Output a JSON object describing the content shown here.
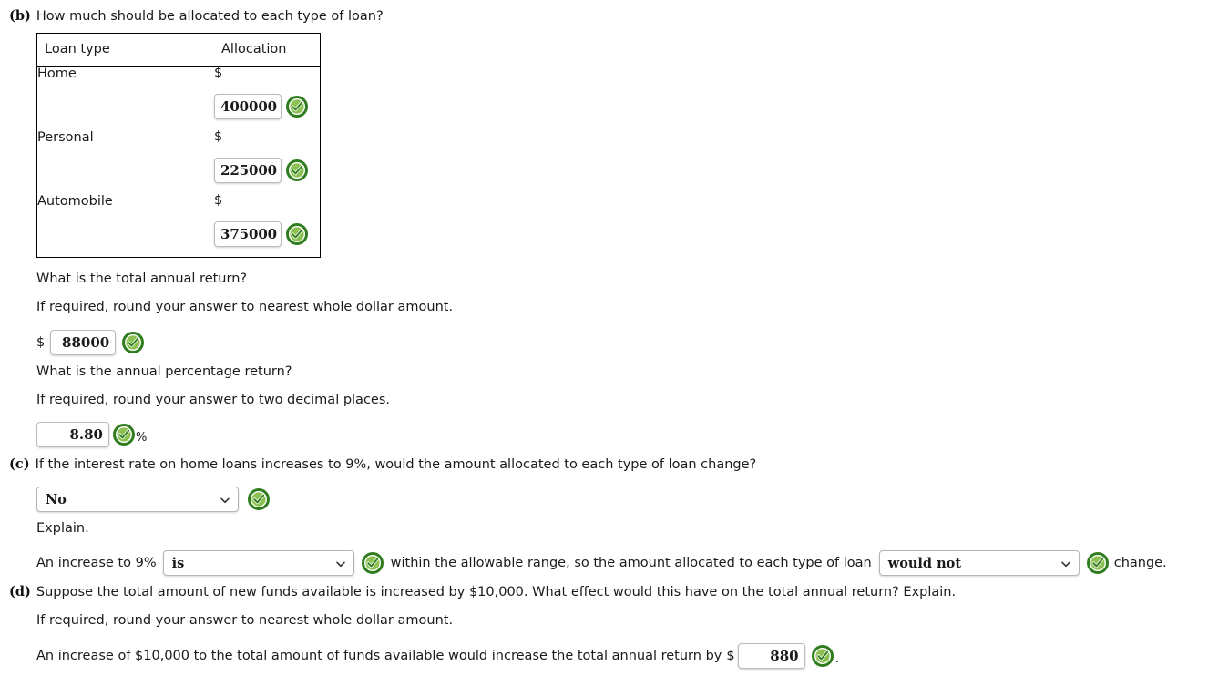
{
  "colors": {
    "check_ring_outer": "#2f7d1e",
    "check_ring_inner": "#7ab648",
    "check_mark": "#2f7d1e",
    "table_border": "#000000",
    "text": "#1a1a1a"
  },
  "part_b": {
    "label": "(b)",
    "question": "How much should be allocated to each type of loan?",
    "table": {
      "headers": [
        "Loan type",
        "Allocation"
      ],
      "rows": [
        {
          "loan_type": "Home",
          "currency": "$",
          "value": "400000",
          "status": "correct"
        },
        {
          "loan_type": "Personal",
          "currency": "$",
          "value": "225000",
          "status": "correct"
        },
        {
          "loan_type": "Automobile",
          "currency": "$",
          "value": "375000",
          "status": "correct"
        }
      ]
    },
    "total_return": {
      "question": "What is the total annual return?",
      "hint": "If required, round your answer to nearest whole dollar amount.",
      "currency": "$",
      "value": "88000",
      "status": "correct"
    },
    "percentage_return": {
      "question": "What is the annual percentage return?",
      "hint": "If required, round your answer to two decimal places.",
      "value": "8.80",
      "suffix": "%",
      "status": "correct"
    }
  },
  "part_c": {
    "label": "(c)",
    "question": "If the interest rate on home loans increases to 9%, would the amount allocated to each type of loan change?",
    "answer_select": {
      "value": "No",
      "status": "correct"
    },
    "explain_label": "Explain.",
    "explain_sentence": {
      "prefix": "An increase to 9%",
      "select1": {
        "value": "is",
        "status": "correct"
      },
      "middle": "within the allowable range, so the amount allocated to each type of loan",
      "select2": {
        "value": "would not",
        "status": "correct"
      },
      "suffix": "change."
    }
  },
  "part_d": {
    "label": "(d)",
    "question": "Suppose the total amount of new funds available is increased by $10,000. What effect would this have on the total annual return? Explain.",
    "hint": "If required, round your answer to nearest whole dollar amount.",
    "sentence": {
      "prefix": "An increase of $10,000 to the total amount of funds available would increase the total annual return by",
      "currency": "$",
      "value": "880",
      "suffix": ".",
      "status": "correct"
    }
  },
  "icons": {
    "check": "check-circle-icon",
    "chevron": "chevron-down-icon"
  }
}
